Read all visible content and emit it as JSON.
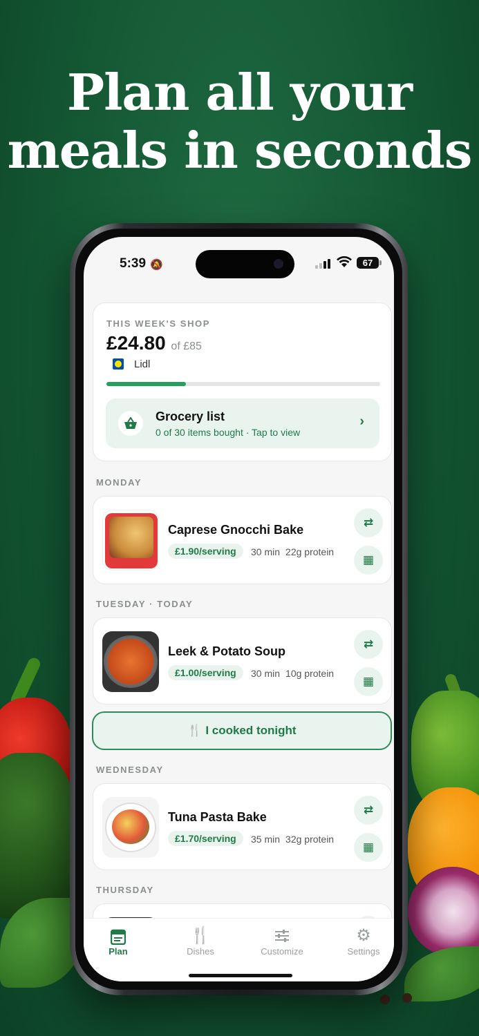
{
  "headline": {
    "line1": "Plan all your",
    "line2": "meals in seconds"
  },
  "status_bar": {
    "time": "5:39",
    "battery": "67"
  },
  "shop": {
    "eyebrow": "THIS WEEK'S SHOP",
    "amount": "£24.80",
    "budget": "of £85",
    "store": "Lidl",
    "progress_fraction": 0.29
  },
  "grocery": {
    "title": "Grocery list",
    "subtitle": "0 of 30 items bought · Tap to view"
  },
  "days": [
    {
      "label": "MONDAY",
      "meal": {
        "title": "Caprese Gnocchi Bake",
        "price": "£1.90/serving",
        "time": "30 min",
        "protein": "22g protein"
      }
    },
    {
      "label": "TUESDAY · TODAY",
      "meal": {
        "title": "Leek & Potato Soup",
        "price": "£1.00/serving",
        "time": "30 min",
        "protein": "10g protein"
      }
    },
    {
      "label": "WEDNESDAY",
      "meal": {
        "title": "Tuna Pasta Bake",
        "price": "£1.70/serving",
        "time": "35 min",
        "protein": "32g protein"
      }
    },
    {
      "label": "THURSDAY"
    }
  ],
  "cooked_button": "I cooked tonight",
  "tabs": [
    {
      "label": "Plan",
      "active": true
    },
    {
      "label": "Dishes"
    },
    {
      "label": "Customize"
    },
    {
      "label": "Settings"
    }
  ],
  "colors": {
    "accent": "#1f7a48",
    "background": "#155a35"
  }
}
